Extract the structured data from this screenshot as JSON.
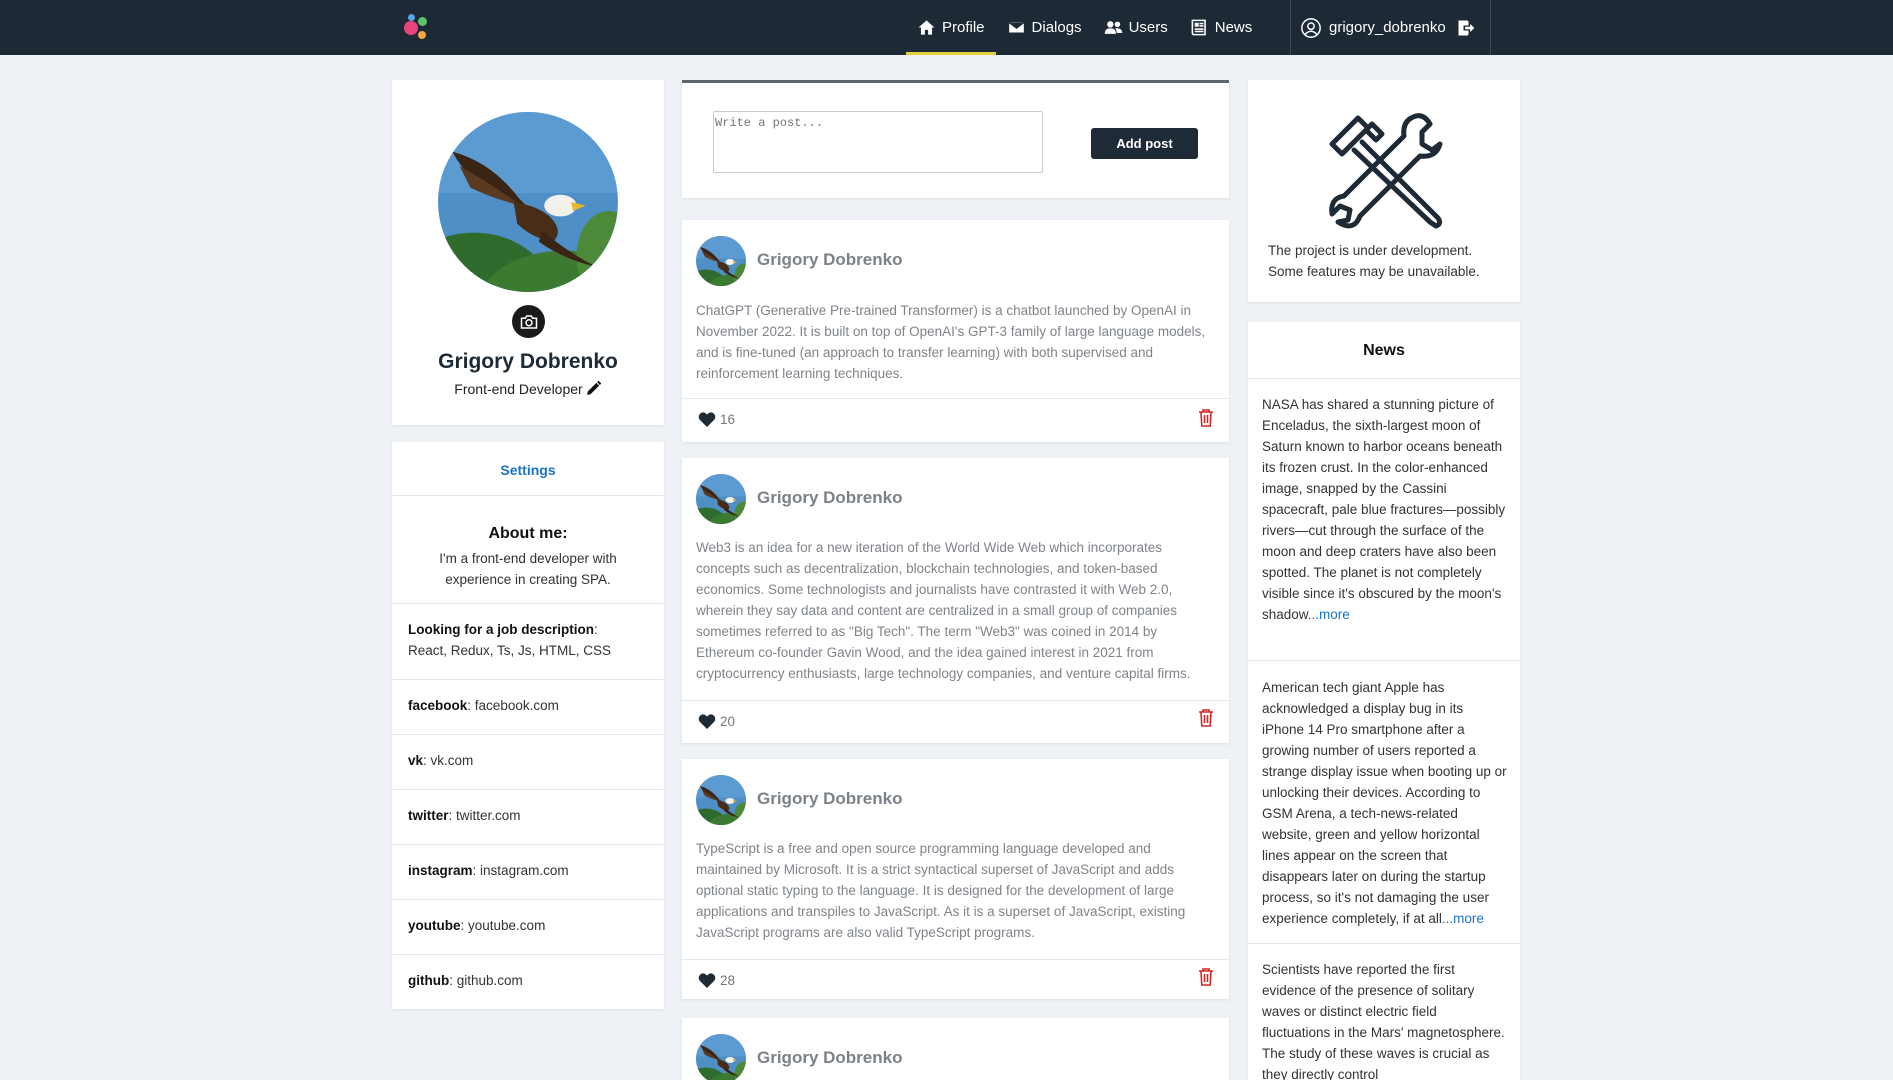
{
  "nav": {
    "items": [
      {
        "label": "Profile",
        "icon": "home-icon",
        "active": true
      },
      {
        "label": "Dialogs",
        "icon": "envelope-icon",
        "active": false
      },
      {
        "label": "Users",
        "icon": "users-icon",
        "active": false
      },
      {
        "label": "News",
        "icon": "newspaper-icon",
        "active": false
      }
    ],
    "username": "grigory_dobrenko",
    "accent_color": "#e6cd3a"
  },
  "profile": {
    "name": "Grigory Dobrenko",
    "title": "Front-end Developer"
  },
  "settings": {
    "link": "Settings",
    "about_heading": "About me:",
    "about_text": "I'm a front-end developer with experience in creating SPA.",
    "job_label": "Looking for a job description",
    "job_value": "React, Redux, Ts, Js, HTML, CSS",
    "contacts": [
      {
        "label": "facebook",
        "value": "facebook.com"
      },
      {
        "label": "vk",
        "value": "vk.com"
      },
      {
        "label": "twitter",
        "value": "twitter.com"
      },
      {
        "label": "instagram",
        "value": "instagram.com"
      },
      {
        "label": "youtube",
        "value": "youtube.com"
      },
      {
        "label": "github",
        "value": "github.com"
      }
    ]
  },
  "post_form": {
    "placeholder": "Write a post...",
    "button": "Add post"
  },
  "posts": [
    {
      "author": "Grigory Dobrenko",
      "text": "ChatGPT (Generative Pre-trained Transformer) is a chatbot launched by OpenAI in November 2022. It is built on top of OpenAI's GPT-3 family of large language models, and is fine-tuned (an approach to transfer learning) with both supervised and reinforcement learning techniques.",
      "likes": "16"
    },
    {
      "author": "Grigory Dobrenko",
      "text": "Web3 is an idea for a new iteration of the World Wide Web which incorporates concepts such as decentralization, blockchain technologies, and token-based economics. Some technologists and journalists have contrasted it with Web 2.0, wherein they say data and content are centralized in a small group of companies sometimes referred to as \"Big Tech\". The term \"Web3\" was coined in 2014 by Ethereum co-founder Gavin Wood, and the idea gained interest in 2021 from cryptocurrency enthusiasts, large technology companies, and venture capital firms.",
      "likes": "20"
    },
    {
      "author": "Grigory Dobrenko",
      "text": "TypeScript is a free and open source programming language developed and maintained by Microsoft. It is a strict syntactical superset of JavaScript and adds optional static typing to the language. It is designed for the development of large applications and transpiles to JavaScript. As it is a superset of JavaScript, existing JavaScript programs are also valid TypeScript programs.",
      "likes": "28"
    },
    {
      "author": "Grigory Dobrenko",
      "text": "",
      "likes": ""
    }
  ],
  "dev_notice": {
    "text": "The project is under development. Some features may be unavailable."
  },
  "news": {
    "heading": "News",
    "more_label": "...more",
    "items": [
      {
        "text": "NASA has shared a stunning picture of Enceladus, the sixth-largest moon of Saturn known to harbor oceans beneath its frozen crust. In the color-enhanced image, snapped by the Cassini spacecraft, pale blue fractures—possibly rivers—cut through the surface of the moon and deep craters have also been spotted. The planet is not completely visible since it's obscured by the moon's shadow"
      },
      {
        "text": "American tech giant Apple has acknowledged a display bug in its iPhone 14 Pro smartphone after a growing number of users reported a strange display issue when booting up or unlocking their devices. According to GSM Arena, a tech-news-related website, green and yellow horizontal lines appear on the screen that disappears later on during the startup process, so it's not damaging the user experience completely, if at all"
      },
      {
        "text": "Scientists have reported the first evidence of the presence of solitary waves or distinct electric field fluctuations in the Mars' magnetosphere. The study of these waves is crucial as they directly control"
      }
    ]
  }
}
